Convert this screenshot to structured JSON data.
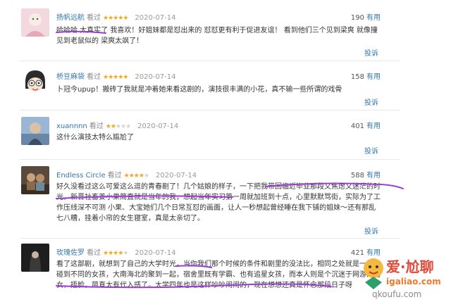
{
  "reviews": [
    {
      "user": "扬帆远航",
      "seen_label": "看过",
      "rating": 5,
      "date": "2020-07-14",
      "votes": "190",
      "vote_label": "有用",
      "text": "哈哈哈 太真实了 我喜欢！好姐妹都是怼出来的 怼怼更有利于促进友谊！ 看到他们三个见到梁爽 就像撞见到老鼠似的 梁爽太飒了！",
      "report_label": "投诉"
    },
    {
      "user": "桥豆麻袋",
      "seen_label": "看过",
      "rating": 5,
      "date": "2020-07-14",
      "votes": "158",
      "vote_label": "有用",
      "text": "卜冠今upup！搬砖了我就是冲着她来看这剧的，演技很丰满的小花，真不输一些所谓的戏骨",
      "report_label": "投诉"
    },
    {
      "user": "xuannnn",
      "seen_label": "看过",
      "rating": 2,
      "date": "2020-07-14",
      "votes": "401",
      "vote_label": "有用",
      "text": "这什么演技太特么尴尬了",
      "report_label": "投诉"
    },
    {
      "user": "Endless Circle",
      "seen_label": "看过",
      "rating": 4,
      "date": "2020-07-14",
      "votes": "588",
      "vote_label": "有用",
      "text": "好久没看过这么可爱这么逗的青春剧了！几个姑娘的样子，一下把我带回临近毕业那段又焦虑又迷茫的时光。新晋社畜姜小果简直就是当年的我，想起当年实习第一周就加班到十点，心里默默骂街，实际为了工作压线深不可测 小果、大宝她们几个日常互怼的画面，让人一秒想起曾经睡在我下铺的姐妹～还有那乱七八糟，挂着小帘的女生寝室，真是太亲切了。",
      "report_label": "投诉"
    },
    {
      "user": "玫瑰佐罗",
      "seen_label": "看过",
      "rating": 4,
      "date": "2020-07-14",
      "votes": "421",
      "vote_label": "有用",
      "text": "看了这部剧，就想到了自己的大学时光，当你我们那个时候的条件和剧里的没法比，相同之处就是一样能碰到不同的女孩，大南海北的聚到一起，宿舍里既有学霸、也有追星女孩，而本人则是个沉迷于网游的宅女，捂脸，简直太有代入感了。大学四年也是这样吵吵闹闹的，现在想想还真是怀念那段日子呀",
      "report_label": "投诉"
    }
  ],
  "watermark": {
    "title": "爱·尬聊",
    "url": "igaliao.com",
    "url2": "qkoufu.com"
  },
  "colors": {
    "link": "#3377aa",
    "star": "#f5a623",
    "highlight_ink": "#9b3bd8"
  }
}
